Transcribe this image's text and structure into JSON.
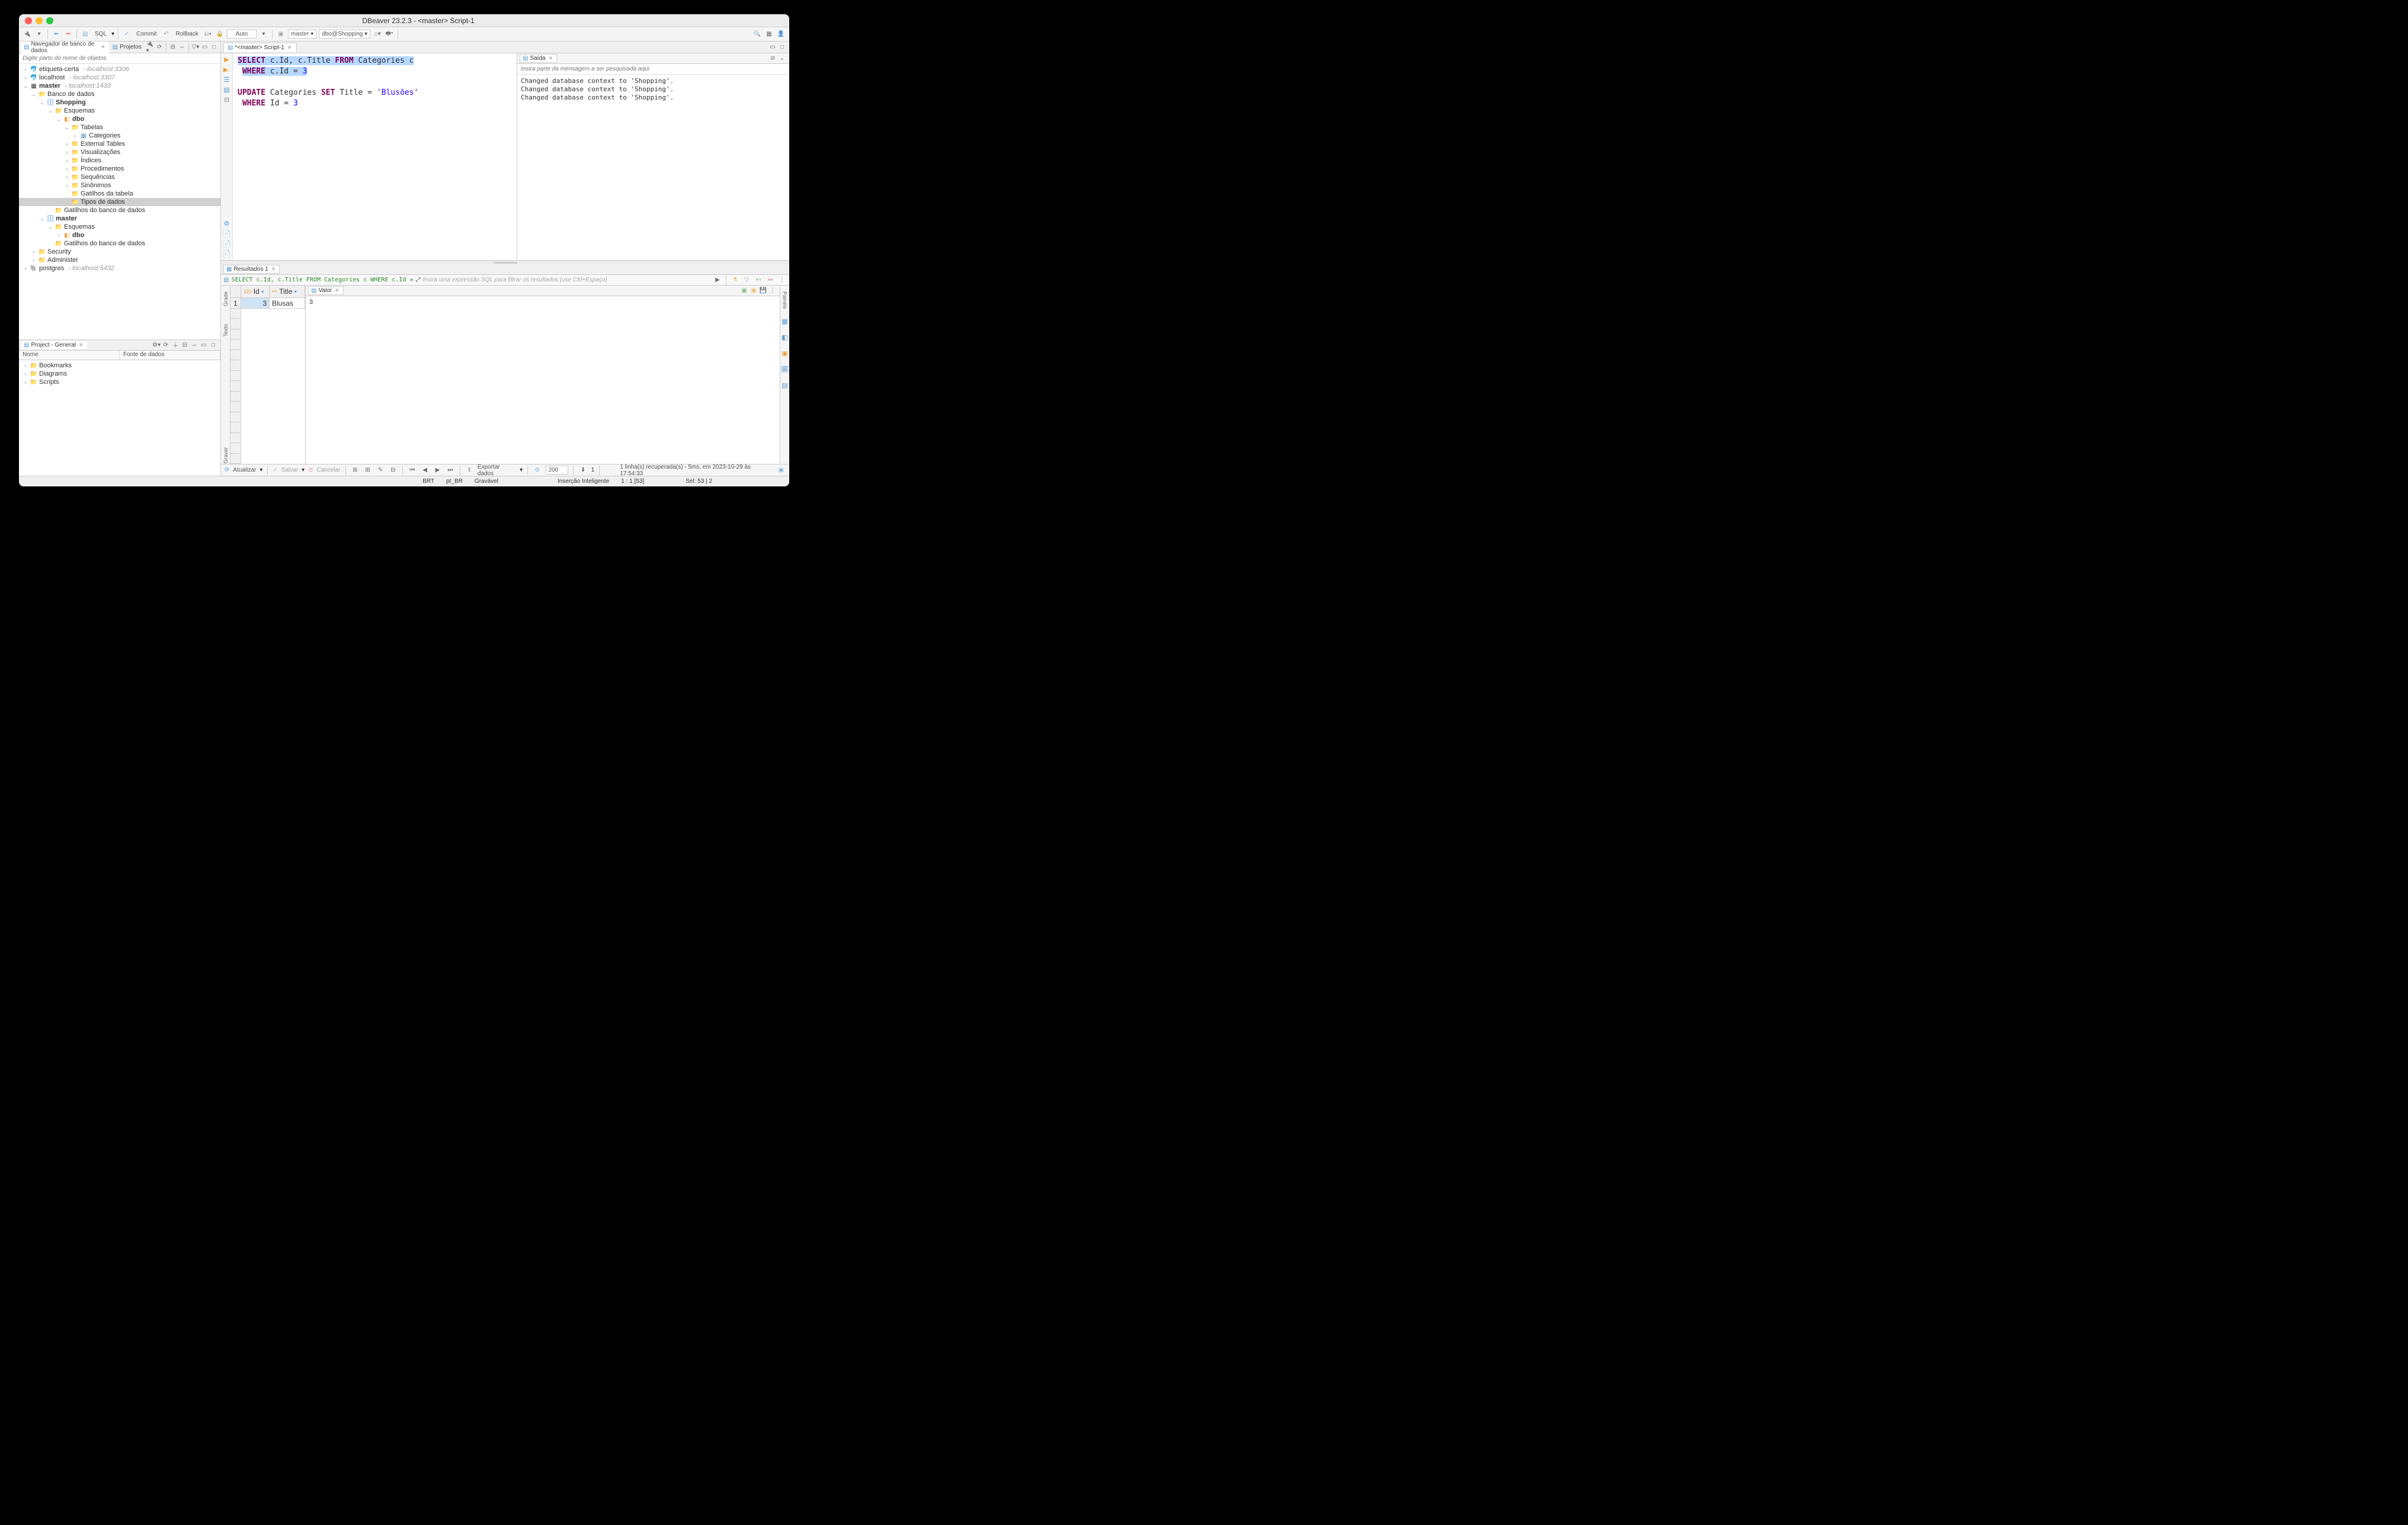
{
  "window": {
    "title": "DBeaver 23.2.3 - <master> Script-1"
  },
  "toolbar": {
    "sql": "SQL",
    "commit": "Commit",
    "rollback": "Rollback",
    "auto": "Auto",
    "conn": "master",
    "db": "dbo@Shopping"
  },
  "nav": {
    "tab1": "Navegador de banco de dados",
    "tab2": "Projetos",
    "filter_placeholder": "Digite parte do nome de objetos"
  },
  "tree": {
    "etiqueta": "etiqueta-certa",
    "etiqueta_host": "- localhost:3306",
    "localhost": "localhost",
    "localhost_host": "- localhost:3307",
    "master": "master",
    "master_host": "- localhost:1433",
    "banco": "Banco de dados",
    "shopping": "Shopping",
    "esquemas": "Esquemas",
    "dbo": "dbo",
    "tabelas": "Tabelas",
    "categories": "Categories",
    "external": "External Tables",
    "viz": "Visualizações",
    "indices": "Índices",
    "proc": "Procedimentos",
    "seq": "Sequências",
    "sin": "Sinônimos",
    "gatilhos_tab": "Gatilhos da tabela",
    "tipos": "Tipos de dados",
    "gatilhos_db": "Gatilhos do banco de dados",
    "master2": "master",
    "esquemas2": "Esquemas",
    "dbo2": "dbo",
    "gatilhos_db2": "Gatilhos do banco de dados",
    "security": "Security",
    "admin": "Administer",
    "postgres": "postgres",
    "postgres_host": "- localhost:5432"
  },
  "editor": {
    "tab": "*<master> Script-1",
    "line1_a": "SELECT",
    "line1_b": " c.Id, c.Title ",
    "line1_c": "FROM",
    "line1_d": " Categories c",
    "line2_a": "WHERE",
    "line2_b": " c.Id = ",
    "line2_c": "3",
    "line3_a": "UPDATE",
    "line3_b": " Categories ",
    "line3_c": "SET",
    "line3_d": " Title = ",
    "line3_e": "'Blusões'",
    "line4_a": "WHERE",
    "line4_b": " Id = ",
    "line4_c": "3"
  },
  "output": {
    "tab": "Saída",
    "search_placeholder": "Insira parte da mensagem a ser pesquisada aqui",
    "l1": "Changed database context to 'Shopping'.",
    "l2": "Changed database context to 'Shopping'.",
    "l3": "Changed database context to 'Shopping'."
  },
  "results": {
    "tab": "Resultados 1",
    "sql": "SELECT c.Id, c.Title FROM Categories c WHERE c.Id =",
    "filter_placeholder": "Insira uma expressão SQL para filtrar os resultados (use Ctrl+Espaço)",
    "col_id": "Id",
    "col_title": "Title",
    "row1_num": "1",
    "row1_id": "3",
    "row1_title": "Blusas",
    "grade": "Grade",
    "texto": "Texto",
    "gravar": "Gravar",
    "valor_tab": "Valor",
    "valor_body": "3",
    "paineis": "Painéis"
  },
  "res_footer": {
    "atualizar": "Atualizar",
    "salvar": "Salvar",
    "cancelar": "Cancelar",
    "exportar": "Exportar dados",
    "limit": "200",
    "rows": "1",
    "status": "1 linha(s) recuperada(s) - 5ms, em 2023-10-29 às 17:54:33"
  },
  "status": {
    "tz": "BRT",
    "locale": "pt_BR",
    "mode": "Gravável",
    "insert": "Inserção Inteligente",
    "pos": "1 : 1 [53]",
    "sel": "Sel: 53 | 2"
  },
  "project": {
    "tab": "Project - General",
    "col1": "Nome",
    "col2": "Fonte de dados",
    "bookmarks": "Bookmarks",
    "diagrams": "Diagrams",
    "scripts": "Scripts"
  }
}
